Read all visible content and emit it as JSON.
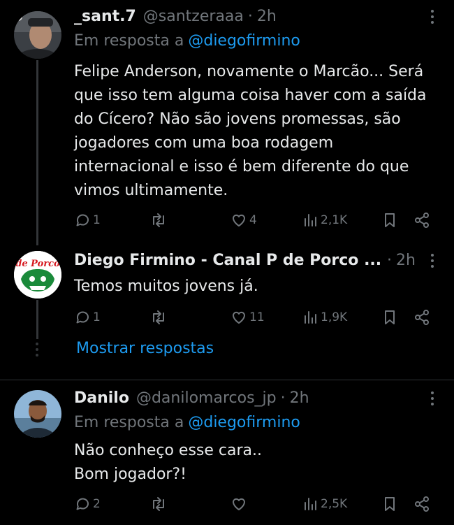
{
  "colors": {
    "background": "#000000",
    "text": "#e7e9ea",
    "muted": "#71767b",
    "accent": "#1d9bf0",
    "divider": "#2f3336"
  },
  "tweets": [
    {
      "name": "_sant.7",
      "handle": "@santzeraaa",
      "separator": "·",
      "time": "2h",
      "reply_prefix": "Em resposta a",
      "reply_mention": "@diegofirmino",
      "text": "Felipe Anderson, novamente o Marcão... Será que isso tem alguma coisa haver com a saída do Cícero? Não são jovens promessas, são jogadores com uma boa rodagem internacional e isso é bem diferente do que vimos ultimamente.",
      "replies": "1",
      "retweets": "",
      "likes": "4",
      "views": "2,1K"
    },
    {
      "name": "Diego Firmino - Canal P de Porco ...",
      "handle": "",
      "separator": "·",
      "time": "2h",
      "avatar_text": "de Porco",
      "text": "Temos muitos jovens já.",
      "replies": "1",
      "retweets": "",
      "likes": "11",
      "views": "1,9K"
    },
    {
      "name": "Danilo",
      "handle": "@danilomarcos_jp",
      "separator": "·",
      "time": "2h",
      "reply_prefix": "Em resposta a",
      "reply_mention": "@diegofirmino",
      "text_lines": [
        "Não conheço esse cara..",
        "Bom jogador?!"
      ],
      "replies": "2",
      "retweets": "",
      "likes": "",
      "views": "2,5K"
    }
  ],
  "show_replies": "Mostrar respostas"
}
